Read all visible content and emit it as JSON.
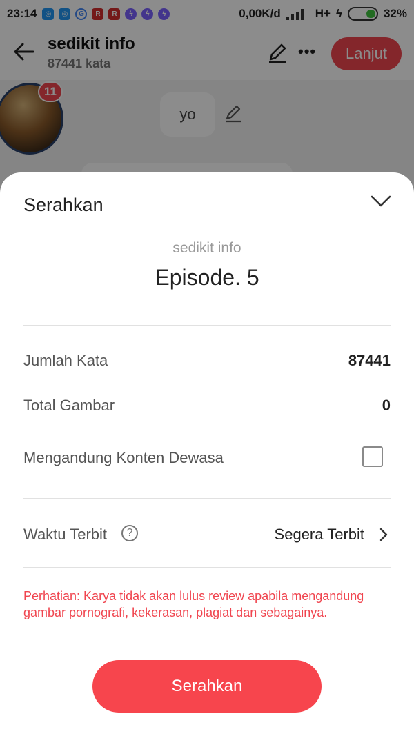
{
  "status_bar": {
    "time": "23:14",
    "speed": "0,00K/d",
    "network": "H+",
    "battery": "32%",
    "battery_level": 0.32,
    "notification_icons": [
      "app-icon",
      "app-icon",
      "google-icon",
      "red-app-icon",
      "red-app-icon",
      "messenger-icon",
      "messenger-icon",
      "messenger-icon"
    ],
    "google_glyph": "G",
    "red_glyph": "R"
  },
  "header": {
    "title": "sedikit info",
    "subtitle": "87441 kata",
    "next_label": "Lanjut"
  },
  "background": {
    "badge_count": "11",
    "chip_text": "yo"
  },
  "sheet": {
    "title": "Serahkan",
    "story_name": "sedikit info",
    "episode": "Episode. 5",
    "rows": {
      "word_count_label": "Jumlah Kata",
      "word_count_value": "87441",
      "image_total_label": "Total Gambar",
      "image_total_value": "0",
      "adult_content_label": "Mengandung Konten Dewasa",
      "publish_time_label": "Waktu Terbit",
      "publish_time_value": "Segera Terbit"
    },
    "help_glyph": "?",
    "warning": "Perhatian: Karya tidak akan lulus review apabila mengandung gambar pornografi, kekerasan, plagiat dan sebagainya.",
    "submit_label": "Serahkan"
  },
  "colors": {
    "accent": "#f0454f",
    "warning_text": "#f0454f"
  }
}
